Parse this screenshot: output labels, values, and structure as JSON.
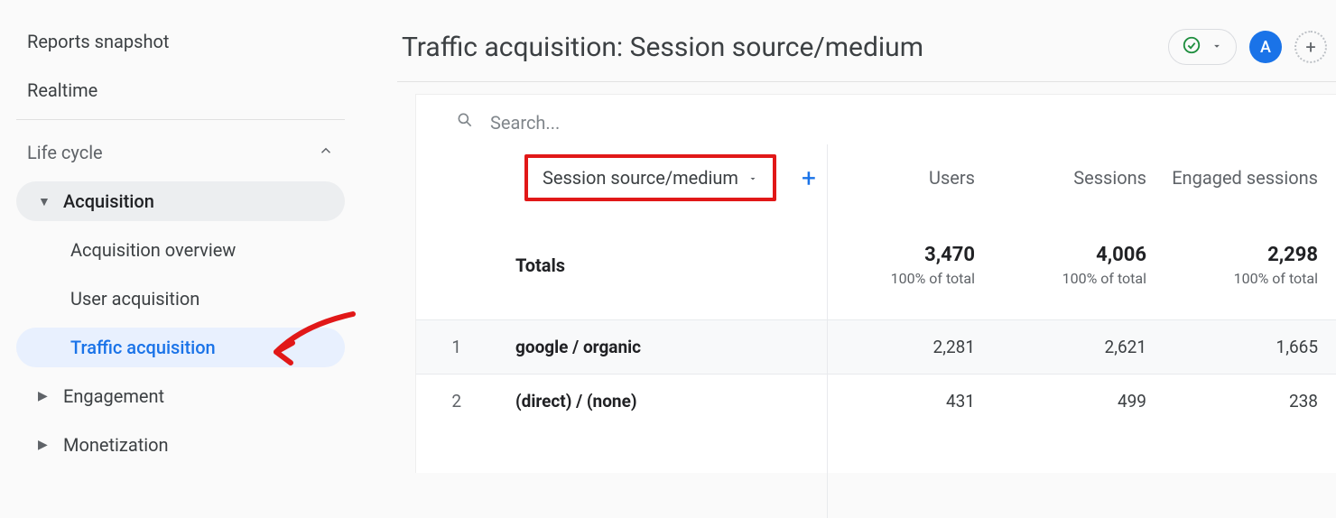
{
  "sidebar": {
    "reports_snapshot": "Reports snapshot",
    "realtime": "Realtime",
    "life_cycle": "Life cycle",
    "acquisition": "Acquisition",
    "acquisition_overview": "Acquisition overview",
    "user_acquisition": "User acquisition",
    "traffic_acquisition": "Traffic acquisition",
    "engagement": "Engagement",
    "monetization": "Monetization"
  },
  "header": {
    "title": "Traffic acquisition: Session source/medium",
    "avatar_letter": "A"
  },
  "search": {
    "placeholder": "Search..."
  },
  "table": {
    "dimension": "Session source/medium",
    "columns": [
      "Users",
      "Sessions",
      "Engaged sessions"
    ],
    "totals_label": "Totals",
    "totals": {
      "users": "3,470",
      "sessions": "4,006",
      "engaged": "2,298",
      "sub": "100% of total"
    },
    "rows": [
      {
        "idx": "1",
        "dim": "google / organic",
        "users": "2,281",
        "sessions": "2,621",
        "engaged": "1,665"
      },
      {
        "idx": "2",
        "dim": "(direct) / (none)",
        "users": "431",
        "sessions": "499",
        "engaged": "238"
      }
    ]
  }
}
